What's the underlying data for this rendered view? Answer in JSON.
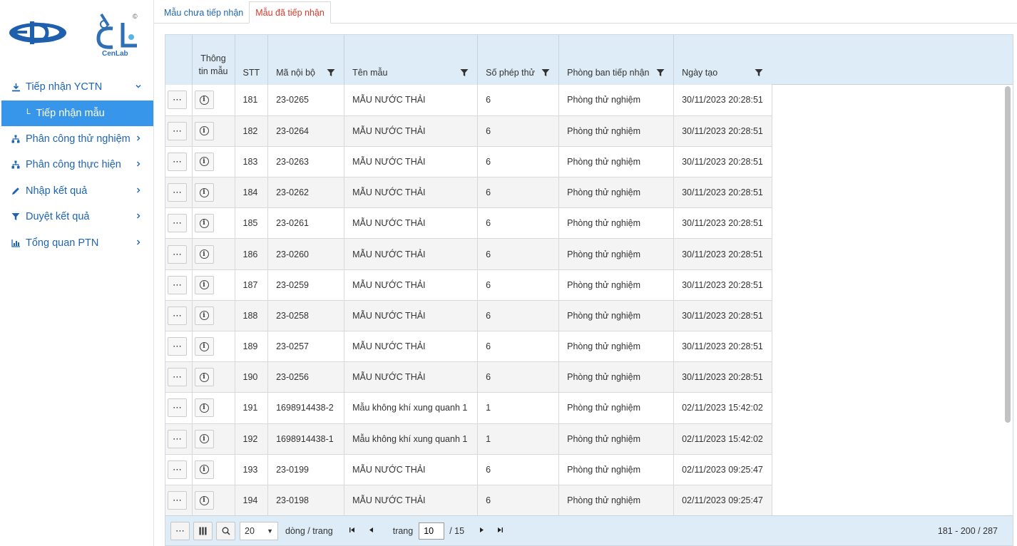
{
  "brand": {
    "logo_caption": "CenLab",
    "copyright": "©"
  },
  "sidebar": {
    "items": [
      {
        "label": "Tiếp nhận YCTN",
        "icon": "download-icon"
      },
      {
        "label": "Tiếp nhận mẫu",
        "icon": "branch-icon"
      },
      {
        "label": "Phân công thử nghiệm",
        "icon": "sitemap-icon"
      },
      {
        "label": "Phân công thực hiện",
        "icon": "sitemap-icon"
      },
      {
        "label": "Nhập kết quả",
        "icon": "pencil-icon"
      },
      {
        "label": "Duyệt kết quả",
        "icon": "filter-icon"
      },
      {
        "label": "Tổng quan PTN",
        "icon": "bar-chart-icon"
      }
    ]
  },
  "tabs": [
    {
      "label": "Mẫu chưa tiếp nhận",
      "active": false
    },
    {
      "label": "Mẫu đã tiếp nhận",
      "active": true
    }
  ],
  "table": {
    "headers": {
      "info": "Thông tin mẫu",
      "stt": "STT",
      "code": "Mã nội bộ",
      "name": "Tên mẫu",
      "tests": "Số phép thử",
      "dept": "Phòng ban tiếp nhận",
      "date": "Ngày tạo"
    },
    "rows": [
      {
        "stt": "181",
        "code": "23-0265",
        "name": "MẪU NƯỚC THẢI",
        "tests": "6",
        "dept": "Phòng thử nghiệm",
        "date": "30/11/2023 20:28:51"
      },
      {
        "stt": "182",
        "code": "23-0264",
        "name": "MẪU NƯỚC THẢI",
        "tests": "6",
        "dept": "Phòng thử nghiệm",
        "date": "30/11/2023 20:28:51"
      },
      {
        "stt": "183",
        "code": "23-0263",
        "name": "MẪU NƯỚC THẢI",
        "tests": "6",
        "dept": "Phòng thử nghiệm",
        "date": "30/11/2023 20:28:51"
      },
      {
        "stt": "184",
        "code": "23-0262",
        "name": "MẪU NƯỚC THẢI",
        "tests": "6",
        "dept": "Phòng thử nghiệm",
        "date": "30/11/2023 20:28:51"
      },
      {
        "stt": "185",
        "code": "23-0261",
        "name": "MẪU NƯỚC THẢI",
        "tests": "6",
        "dept": "Phòng thử nghiệm",
        "date": "30/11/2023 20:28:51"
      },
      {
        "stt": "186",
        "code": "23-0260",
        "name": "MẪU NƯỚC THẢI",
        "tests": "6",
        "dept": "Phòng thử nghiệm",
        "date": "30/11/2023 20:28:51"
      },
      {
        "stt": "187",
        "code": "23-0259",
        "name": "MẪU NƯỚC THẢI",
        "tests": "6",
        "dept": "Phòng thử nghiệm",
        "date": "30/11/2023 20:28:51"
      },
      {
        "stt": "188",
        "code": "23-0258",
        "name": "MẪU NƯỚC THẢI",
        "tests": "6",
        "dept": "Phòng thử nghiệm",
        "date": "30/11/2023 20:28:51"
      },
      {
        "stt": "189",
        "code": "23-0257",
        "name": "MẪU NƯỚC THẢI",
        "tests": "6",
        "dept": "Phòng thử nghiệm",
        "date": "30/11/2023 20:28:51"
      },
      {
        "stt": "190",
        "code": "23-0256",
        "name": "MẪU NƯỚC THẢI",
        "tests": "6",
        "dept": "Phòng thử nghiệm",
        "date": "30/11/2023 20:28:51"
      },
      {
        "stt": "191",
        "code": "1698914438-2",
        "name": "Mẫu không khí xung quanh 1",
        "tests": "1",
        "dept": "Phòng thử nghiệm",
        "date": "02/11/2023 15:42:02"
      },
      {
        "stt": "192",
        "code": "1698914438-1",
        "name": "Mẫu không khí xung quanh 1",
        "tests": "1",
        "dept": "Phòng thử nghiệm",
        "date": "02/11/2023 15:42:02"
      },
      {
        "stt": "193",
        "code": "23-0199",
        "name": "MẪU NƯỚC THẢI",
        "tests": "6",
        "dept": "Phòng thử nghiệm",
        "date": "02/11/2023 09:25:47"
      },
      {
        "stt": "194",
        "code": "23-0198",
        "name": "MẪU NƯỚC THẢI",
        "tests": "6",
        "dept": "Phòng thử nghiệm",
        "date": "02/11/2023 09:25:47"
      }
    ]
  },
  "pager": {
    "page_size": "20",
    "rows_per_page_label": "dòng / trang",
    "page_label": "trang",
    "current_page": "10",
    "total_pages": "/ 15",
    "range": "181 - 200 / 287"
  },
  "colors": {
    "accent": "#1f64b3",
    "active_tab": "#d93a2c",
    "selected_nav": "#3896ea",
    "header_bg": "#ddecf6"
  }
}
